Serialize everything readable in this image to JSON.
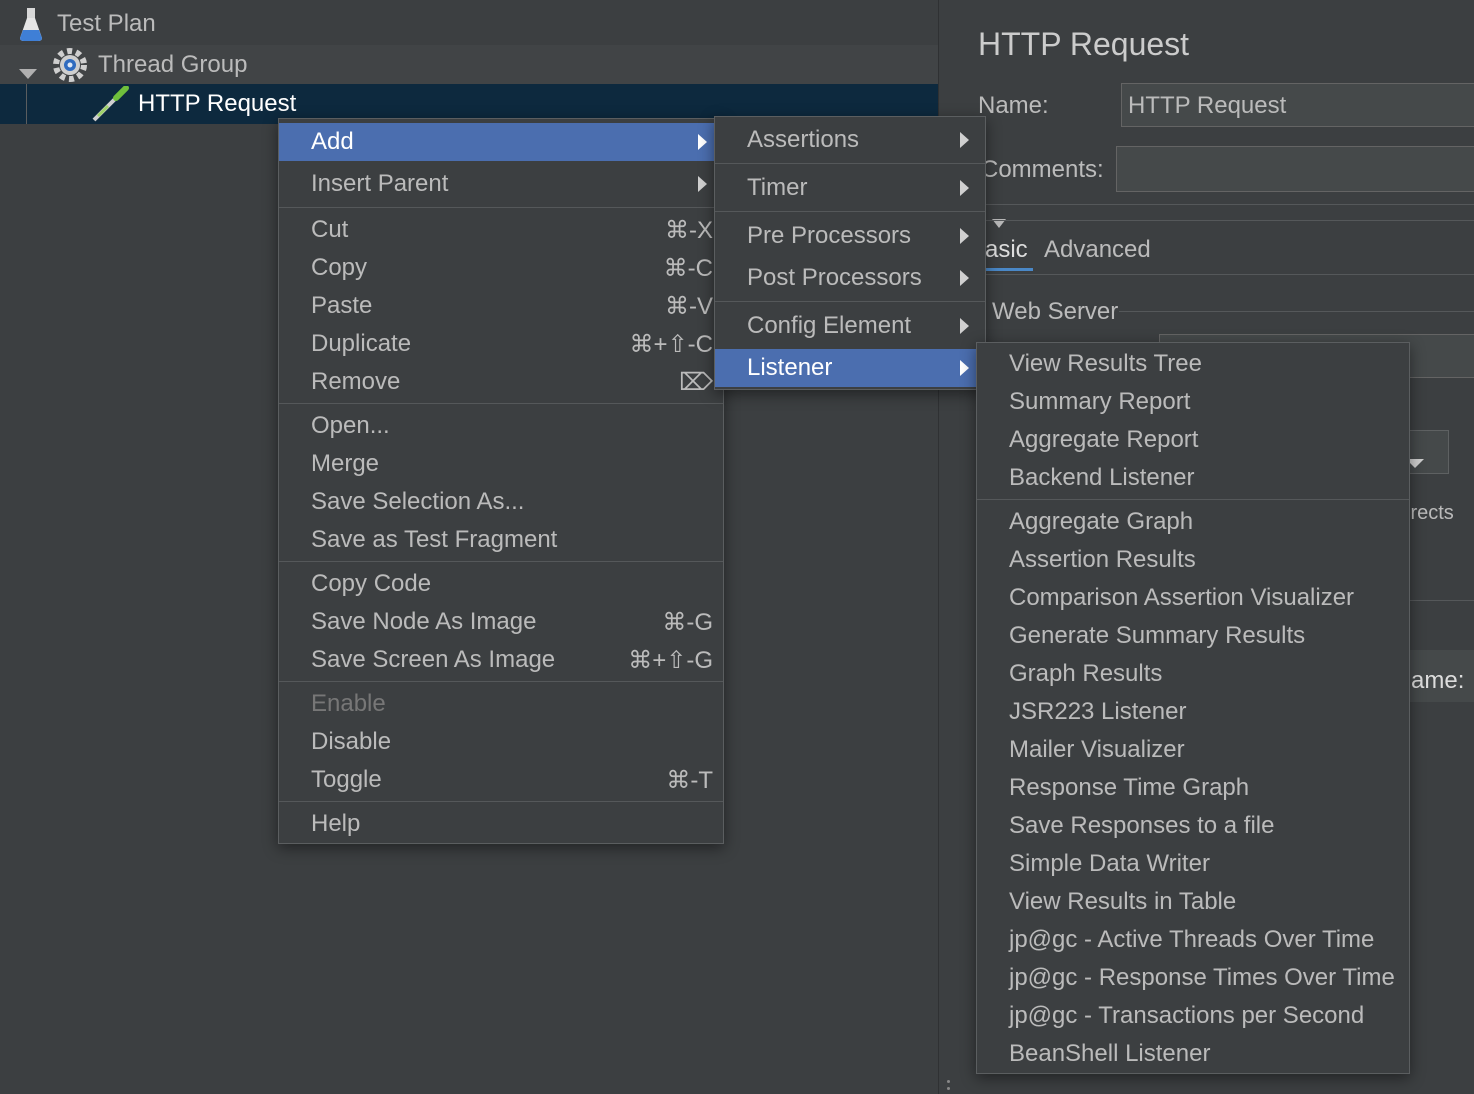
{
  "tree": {
    "items": [
      {
        "label": "Test Plan",
        "icon": "flask-icon"
      },
      {
        "label": "Thread Group",
        "icon": "gear-icon"
      },
      {
        "label": "HTTP Request",
        "icon": "pipette-icon"
      }
    ]
  },
  "right_panel": {
    "title": "HTTP Request",
    "name_label": "Name:",
    "name_value": "HTTP Request",
    "comments_label": "Comments:",
    "tab_basic": "asic",
    "tab_advanced": "Advanced",
    "web_server_label": "Web Server",
    "redirects_text": "irects",
    "name_partial": "ame:"
  },
  "context_menu": {
    "add": "Add",
    "insert_parent": "Insert Parent",
    "cut": "Cut",
    "cut_shortcut": "⌘-X",
    "copy": "Copy",
    "copy_shortcut": "⌘-C",
    "paste": "Paste",
    "paste_shortcut": "⌘-V",
    "duplicate": "Duplicate",
    "duplicate_shortcut": "⌘+⇧-C",
    "remove": "Remove",
    "remove_shortcut": "⌦",
    "open": "Open...",
    "merge": "Merge",
    "save_selection": "Save Selection As...",
    "save_fragment": "Save as Test Fragment",
    "copy_code": "Copy Code",
    "save_node_image": "Save Node As Image",
    "save_node_image_shortcut": "⌘-G",
    "save_screen_image": "Save Screen As Image",
    "save_screen_image_shortcut": "⌘+⇧-G",
    "enable": "Enable",
    "disable": "Disable",
    "toggle": "Toggle",
    "toggle_shortcut": "⌘-T",
    "help": "Help"
  },
  "add_submenu": {
    "assertions": "Assertions",
    "timer": "Timer",
    "pre_processors": "Pre Processors",
    "post_processors": "Post Processors",
    "config_element": "Config Element",
    "listener": "Listener"
  },
  "listener_submenu": {
    "items": [
      "View Results Tree",
      "Summary Report",
      "Aggregate Report",
      "Backend Listener",
      "Aggregate Graph",
      "Assertion Results",
      "Comparison Assertion Visualizer",
      "Generate Summary Results",
      "Graph Results",
      "JSR223 Listener",
      "Mailer Visualizer",
      "Response Time Graph",
      "Save Responses to a file",
      "Simple Data Writer",
      "View Results in Table",
      "jp@gc - Active Threads Over Time",
      "jp@gc - Response Times Over Time",
      "jp@gc - Transactions per Second",
      "BeanShell Listener"
    ]
  },
  "colors": {
    "background": "#3c3f41",
    "selection": "#0d293e",
    "menu_highlight": "#4b6eaf",
    "text": "#bbbbbb"
  }
}
